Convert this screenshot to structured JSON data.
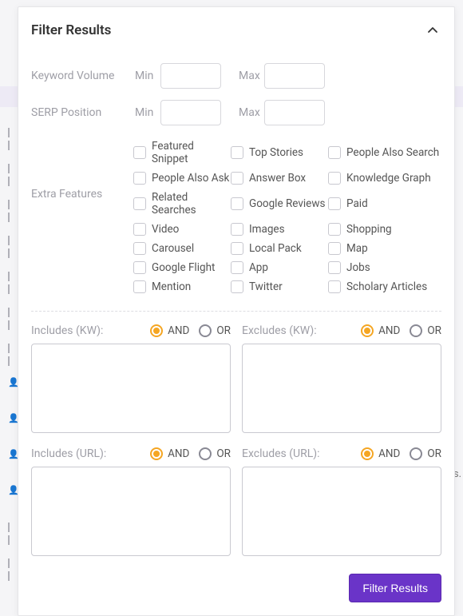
{
  "header": {
    "title": "Filter Results"
  },
  "rows": {
    "keywordVolume": {
      "label": "Keyword Volume",
      "min": "Min",
      "max": "Max"
    },
    "serpPosition": {
      "label": "SERP Position",
      "min": "Min",
      "max": "Max"
    }
  },
  "extraFeatures": {
    "label": "Extra Features",
    "items": [
      "Featured Snippet",
      "Top Stories",
      "People Also Search",
      "People Also Ask",
      "Answer Box",
      "Knowledge Graph",
      "Related Searches",
      "Google Reviews",
      "Paid",
      "Video",
      "Images",
      "Shopping",
      "Carousel",
      "Local Pack",
      "Map",
      "Google Flight",
      "App",
      "Jobs",
      "Mention",
      "Twitter",
      "Scholary Articles"
    ]
  },
  "radios": {
    "and": "AND",
    "or": "OR"
  },
  "incExc": {
    "includesKw": "Includes (KW):",
    "excludesKw": "Excludes (KW):",
    "includesUrl": "Includes (URL):",
    "excludesUrl": "Excludes (URL):"
  },
  "footer": {
    "submit": "Filter Results"
  },
  "bgText": "s."
}
